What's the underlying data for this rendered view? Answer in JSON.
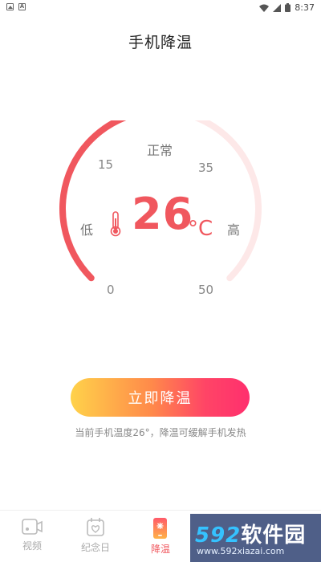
{
  "status_bar": {
    "time": "8:37"
  },
  "page": {
    "title": "手机降温"
  },
  "gauge": {
    "status_label": "正常",
    "tick_0": "0",
    "tick_15": "15",
    "tick_35": "35",
    "tick_50": "50",
    "low_label": "低",
    "high_label": "高",
    "temperature": "26",
    "unit": "°C",
    "min": 0,
    "max": 50,
    "value": 26,
    "fill_color": "#f0575e",
    "track_color": "#fde8e8"
  },
  "action": {
    "button_label": "立即降温",
    "hint": "当前手机温度26°，降温可缓解手机发热"
  },
  "nav": {
    "items": [
      {
        "label": "视频",
        "icon": "video-icon"
      },
      {
        "label": "纪念日",
        "icon": "calendar-heart-icon"
      },
      {
        "label": "降温",
        "icon": "phone-cool-icon"
      }
    ],
    "active_color": "#f0575e",
    "inactive_color": "#aaaaaa"
  },
  "watermark": {
    "main_prefix": "592",
    "main_suffix": "软件园",
    "url": "www.592xiazai.com"
  }
}
